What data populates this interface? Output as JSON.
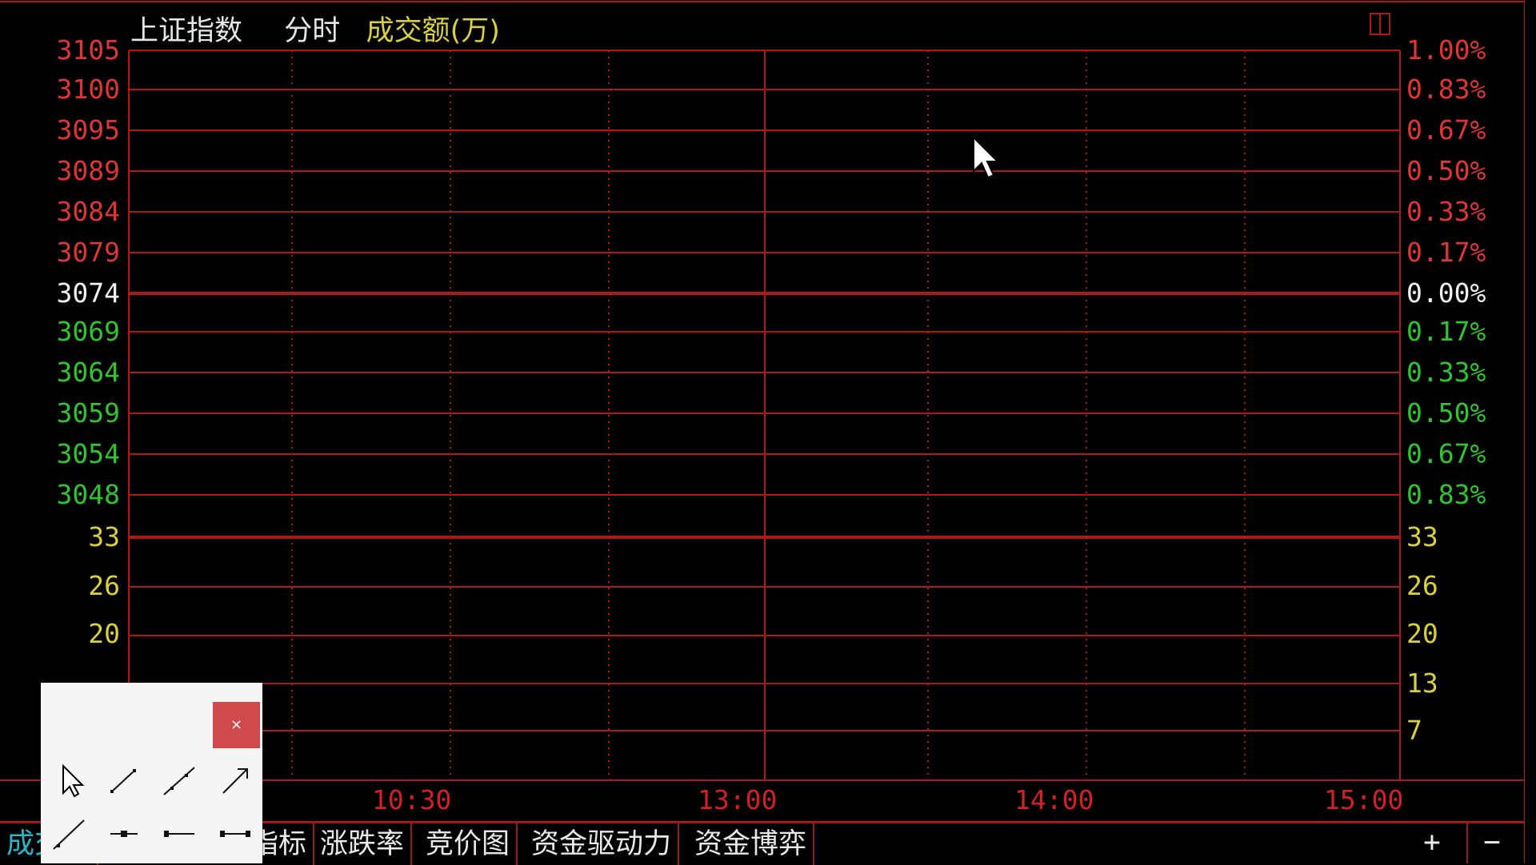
{
  "header": {
    "index_name": "上证指数",
    "mode": "分时",
    "volume_label": "成交额(万)"
  },
  "price_axis": {
    "left_labels": [
      {
        "text": "3105",
        "tone": "red"
      },
      {
        "text": "3100",
        "tone": "red"
      },
      {
        "text": "3095",
        "tone": "red"
      },
      {
        "text": "3089",
        "tone": "red"
      },
      {
        "text": "3084",
        "tone": "red"
      },
      {
        "text": "3079",
        "tone": "red"
      },
      {
        "text": "3074",
        "tone": "white"
      },
      {
        "text": "3069",
        "tone": "green"
      },
      {
        "text": "3064",
        "tone": "green"
      },
      {
        "text": "3059",
        "tone": "green"
      },
      {
        "text": "3054",
        "tone": "green"
      },
      {
        "text": "3048",
        "tone": "green"
      }
    ],
    "right_labels": [
      {
        "text": "1.00%",
        "tone": "red"
      },
      {
        "text": "0.83%",
        "tone": "red"
      },
      {
        "text": "0.67%",
        "tone": "red"
      },
      {
        "text": "0.50%",
        "tone": "red"
      },
      {
        "text": "0.33%",
        "tone": "red"
      },
      {
        "text": "0.17%",
        "tone": "red"
      },
      {
        "text": "0.00%",
        "tone": "white"
      },
      {
        "text": "0.17%",
        "tone": "green"
      },
      {
        "text": "0.33%",
        "tone": "green"
      },
      {
        "text": "0.50%",
        "tone": "green"
      },
      {
        "text": "0.67%",
        "tone": "green"
      },
      {
        "text": "0.83%",
        "tone": "green"
      }
    ]
  },
  "volume_axis": {
    "left_labels": [
      "33",
      "26",
      "20",
      "13",
      "7"
    ],
    "right_labels": [
      "33",
      "26",
      "20",
      "13",
      "7"
    ]
  },
  "time_axis": [
    "10:30",
    "13:00",
    "14:00",
    "15:00"
  ],
  "tabs": [
    {
      "label": "成交额",
      "active": true
    },
    {
      "label": "指标",
      "active": false
    },
    {
      "label": "涨跌率",
      "active": false
    },
    {
      "label": "竞价图",
      "active": false
    },
    {
      "label": "资金驱动力",
      "active": false
    },
    {
      "label": "资金博弈",
      "active": false
    }
  ],
  "zoom": {
    "plus": "+",
    "minus": "−"
  },
  "toolbox": {
    "close_label": "×",
    "tools": [
      "pointer",
      "line-segment",
      "line-segment-2",
      "arrow-line",
      "ray-line",
      "horizontal-segment",
      "horizontal-line",
      "horizontal-ray"
    ]
  },
  "colors": {
    "grid_red": "#b01818",
    "axis_up": "#e03535",
    "axis_down": "#2fc52f",
    "volume_label": "#d9cf3f",
    "active_tab": "#2ab5c9",
    "close_button": "#d04a4d"
  }
}
